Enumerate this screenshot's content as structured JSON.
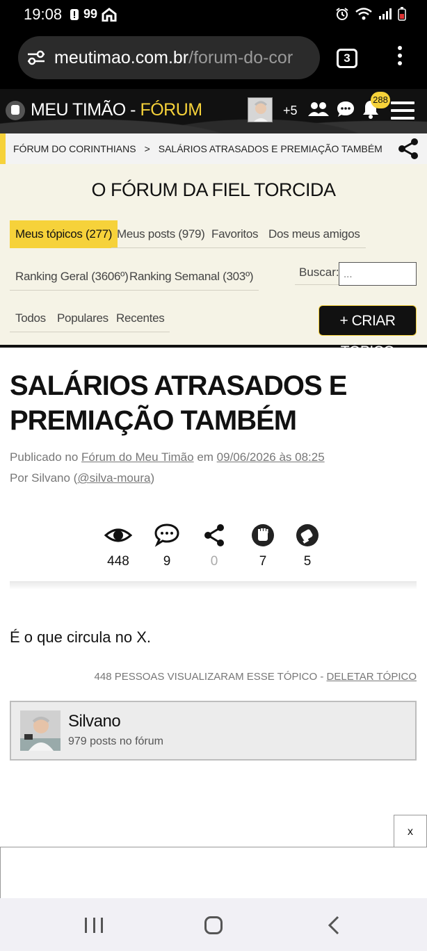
{
  "status_bar": {
    "time": "19:08",
    "notif_count": "99"
  },
  "browser": {
    "url_main": "meutimao.com.br",
    "url_path": "/forum-do-cor",
    "tab_count": "3"
  },
  "header": {
    "brand": "MEU TIMÃO",
    "brand_sep": " - ",
    "brand_section": "FÓRUM",
    "avatar_extra": "+5",
    "notifications": "288"
  },
  "breadcrumb": {
    "root": "FÓRUM DO CORINTHIANS",
    "separator": ">",
    "current": "SALÁRIOS ATRASADOS E PREMIAÇÃO TAMBÉM"
  },
  "forum_menu": {
    "title": "O FÓRUM DA FIEL TORCIDA",
    "tabs_row1": [
      "Meus tópicos (277)",
      "Meus posts (979)",
      "Favoritos",
      "Dos meus amigos"
    ],
    "tabs_row2": [
      "Ranking Geral (3606º)",
      "Ranking Semanal (303º)"
    ],
    "search_label": "Buscar:",
    "search_placeholder": "...",
    "tabs_row3": [
      "Todos",
      "Populares",
      "Recentes"
    ],
    "create_button": "+ CRIAR TÓPICO"
  },
  "topic": {
    "title": "SALÁRIOS ATRASADOS E PREMIAÇÃO TAMBÉM",
    "published_prefix": "Publicado no ",
    "forum_link": "Fórum do Meu Timão",
    "published_mid": " em ",
    "date_link": "09/06/2026 às 08:25",
    "by_prefix": "Por Silvano (",
    "user_link": "@silva-moura",
    "by_suffix": ")",
    "stats": {
      "views": "448",
      "comments": "9",
      "shares": "0",
      "likes": "7",
      "dislikes": "5"
    },
    "body": "É o que circula no X.",
    "views_text": "448 PESSOAS VISUALIZARAM ESSE TÓPICO - ",
    "delete_link": "DELETAR TÓPICO"
  },
  "author": {
    "name": "Silvano",
    "posts": "979 posts no fórum"
  },
  "ad": {
    "close_label": "x"
  },
  "colors": {
    "accent": "#f6d23a",
    "header_bg": "#111111",
    "menu_bg": "#f5f3e6"
  }
}
